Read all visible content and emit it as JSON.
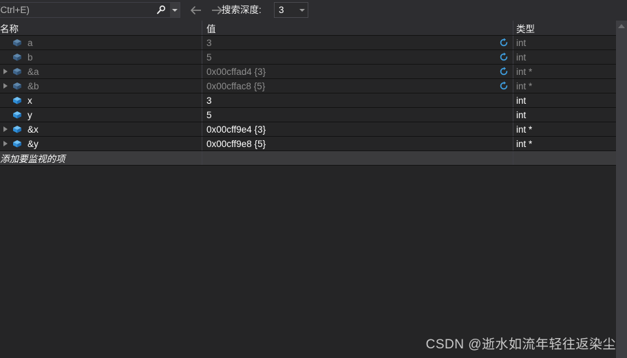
{
  "toolbar": {
    "search_placeholder": "搜索(Ctrl+E)",
    "search_value": "",
    "search_icon": "magnifier-icon",
    "search_dropdown_icon": "chevron-down-icon",
    "back_icon": "arrow-left-icon",
    "forward_icon": "arrow-right-icon",
    "depth_label": "搜索深度:",
    "depth_value": "3",
    "depth_dropdown_icon": "chevron-down-icon"
  },
  "grid": {
    "columns": [
      {
        "key": "name",
        "label": "名称"
      },
      {
        "key": "value",
        "label": "值"
      },
      {
        "key": "type",
        "label": "类型"
      }
    ],
    "rows": [
      {
        "name": "a",
        "value": "3",
        "type": "int",
        "state": "dim",
        "expandable": false,
        "refresh": true
      },
      {
        "name": "b",
        "value": "5",
        "type": "int",
        "state": "dim",
        "expandable": false,
        "refresh": true
      },
      {
        "name": "&a",
        "value": "0x00cffad4 {3}",
        "type": "int *",
        "state": "dim",
        "expandable": true,
        "refresh": true
      },
      {
        "name": "&b",
        "value": "0x00cffac8 {5}",
        "type": "int *",
        "state": "dim",
        "expandable": true,
        "refresh": true
      },
      {
        "name": "x",
        "value": "3",
        "type": "int",
        "state": "bright",
        "expandable": false,
        "refresh": false
      },
      {
        "name": "y",
        "value": "5",
        "type": "int",
        "state": "bright",
        "expandable": false,
        "refresh": false
      },
      {
        "name": "&x",
        "value": "0x00cff9e4 {3}",
        "type": "int *",
        "state": "bright",
        "expandable": true,
        "refresh": false
      },
      {
        "name": "&y",
        "value": "0x00cff9e8 {5}",
        "type": "int *",
        "state": "bright",
        "expandable": true,
        "refresh": false
      }
    ],
    "add_row_placeholder": "添加要监视的项",
    "variable_icon": "cube-icon",
    "refresh_icon": "refresh-circular-arrow-icon",
    "expander_icon": "triangle-right-icon"
  },
  "scrollbar": {
    "up_arrow_icon": "triangle-up-icon"
  },
  "watermark": {
    "text": "CSDN @逝水如流年轻往返染尘"
  },
  "colors": {
    "background": "#252526",
    "toolbar": "#2d2d30",
    "accent_blue": "#3f9fe0",
    "dim_text": "#8e8e8e",
    "bright_text": "#ffffff",
    "gridline": "#121212"
  }
}
